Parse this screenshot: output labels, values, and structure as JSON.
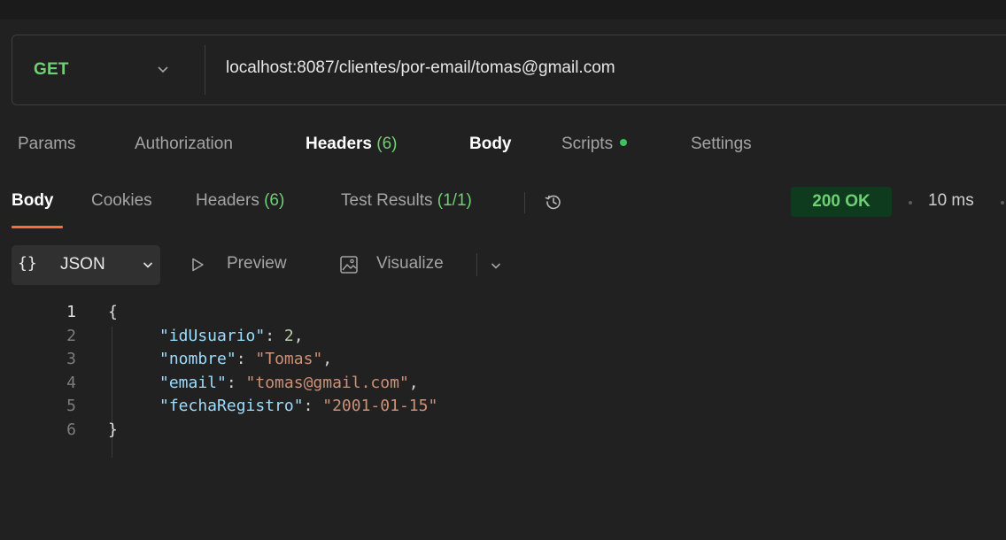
{
  "request": {
    "method": "GET",
    "url": "localhost:8087/clientes/por-email/tomas@gmail.com"
  },
  "request_tabs": {
    "params": "Params",
    "authorization": "Authorization",
    "headers_label": "Headers",
    "headers_count": "(6)",
    "body": "Body",
    "scripts": "Scripts",
    "settings": "Settings"
  },
  "response_tabs": {
    "body": "Body",
    "cookies": "Cookies",
    "headers_label": "Headers",
    "headers_count": "(6)",
    "tests_label": "Test Results",
    "tests_count": "(1/1)"
  },
  "response_meta": {
    "status": "200 OK",
    "time": "10 ms"
  },
  "format_bar": {
    "format_braces": "{}",
    "format_label": "JSON",
    "preview_label": "Preview",
    "visualize_label": "Visualize"
  },
  "code_lines": [
    {
      "n": "1",
      "brace": "{"
    },
    {
      "n": "2",
      "key": "\"idUsuario\"",
      "sep": ": ",
      "value": "2",
      "value_type": "num",
      "trail": ","
    },
    {
      "n": "3",
      "key": "\"nombre\"",
      "sep": ": ",
      "value": "\"Tomas\"",
      "value_type": "str",
      "trail": ","
    },
    {
      "n": "4",
      "key": "\"email\"",
      "sep": ": ",
      "value": "\"tomas@gmail.com\"",
      "value_type": "str",
      "trail": ","
    },
    {
      "n": "5",
      "key": "\"fechaRegistro\"",
      "sep": ": ",
      "value": "\"2001-01-15\"",
      "value_type": "str",
      "trail": ""
    },
    {
      "n": "6",
      "brace": "}"
    }
  ],
  "colors": {
    "method_green": "#6fcf74",
    "status_badge_bg": "#0e3b1d",
    "active_tab_underline": "#ff6c37",
    "json_key": "#9cdcfe",
    "json_string": "#ce9178",
    "json_number": "#b5cea8"
  },
  "icons": {
    "method_dropdown": "chevron-down-icon",
    "scripts_status": "green-dot-icon",
    "history": "history-icon",
    "preview": "play-outline-icon",
    "visualize": "image-icon",
    "visualize_dropdown": "chevron-down-icon"
  }
}
